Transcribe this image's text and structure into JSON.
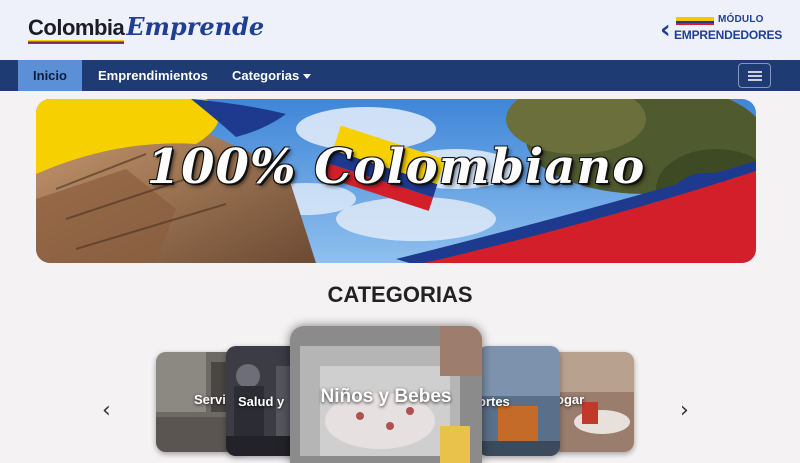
{
  "header": {
    "logo_part1": "Colombia",
    "logo_part2": "Emprende",
    "modulo_line1": "MÓDULO",
    "modulo_line2": "EMPRENDEDORES"
  },
  "nav": {
    "items": [
      {
        "label": "Inicio",
        "active": true
      },
      {
        "label": "Emprendimientos",
        "active": false
      },
      {
        "label": "Categorias",
        "active": false,
        "dropdown": true
      }
    ],
    "toggler_icon": "hamburger-icon"
  },
  "banner": {
    "text": "100% Colombiano"
  },
  "categories": {
    "title": "CATEGORIAS",
    "prev_icon": "chevron-left-icon",
    "next_icon": "chevron-right-icon",
    "cards": [
      {
        "label": "Servi"
      },
      {
        "label": "Salud y"
      },
      {
        "label": "Niños y Bebes",
        "active": true
      },
      {
        "label": "ortes"
      },
      {
        "label": "ogar"
      }
    ]
  },
  "colors": {
    "navbar": "#1f3b73",
    "nav_active": "#5b8fd6",
    "header_bg": "#eef1fa",
    "flag_yellow": "#f7d000",
    "flag_blue": "#1d3a8f",
    "flag_red": "#d21f2a"
  }
}
